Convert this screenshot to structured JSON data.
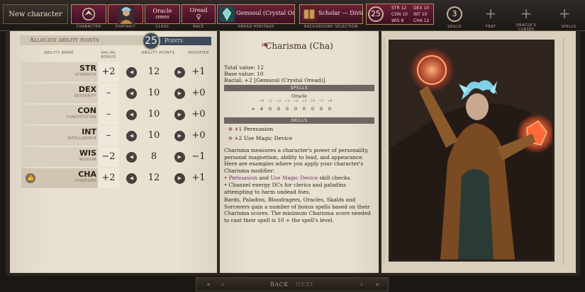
{
  "top": {
    "new_character": "New character",
    "steps": [
      {
        "label": "CHARACTER",
        "text": ""
      },
      {
        "label": "PORTRAIT",
        "text": ""
      },
      {
        "label": "CLASS",
        "text": "Oracle",
        "sub": "SEEKER"
      },
      {
        "label": "RACE",
        "text": "Oread"
      },
      {
        "label": "OREAD HERITAGE",
        "text": "Gemsoul (Crystal Oread)"
      },
      {
        "label": "BACKGROUND SELECTION",
        "text": "Scholar — Divine"
      }
    ],
    "points_total": "25",
    "stats": [
      {
        "k": "STR",
        "v": "12"
      },
      {
        "k": "DEX",
        "v": "10"
      },
      {
        "k": "CON",
        "v": "10"
      },
      {
        "k": "INT",
        "v": "10"
      },
      {
        "k": "WIS",
        "v": "8"
      },
      {
        "k": "CHA",
        "v": "12"
      }
    ],
    "skills_count": "3",
    "skills_label": "SKILLS",
    "feat_label": "FEAT",
    "oracle_curses_label": "ORACLE'S CURSES",
    "spells_label": "SPELLS"
  },
  "allocate": {
    "title": "Allocate ability points",
    "points_left": "25",
    "points_label": "Points",
    "headers": {
      "name": "ABILITY NAME",
      "bonus": "RACIAL BONUS",
      "points": "ABILITY POINTS",
      "modifier": "MODIFIER"
    },
    "rows": [
      {
        "abbr": "STR",
        "full": "STRENGTH",
        "bonus": "+2",
        "value": "12",
        "mod": "+1"
      },
      {
        "abbr": "DEX",
        "full": "DEXTERITY",
        "bonus": "–",
        "value": "10",
        "mod": "+0"
      },
      {
        "abbr": "CON",
        "full": "CONSTITUTION",
        "bonus": "–",
        "value": "10",
        "mod": "+0"
      },
      {
        "abbr": "INT",
        "full": "INTELLIGENCE",
        "bonus": "–",
        "value": "10",
        "mod": "+0"
      },
      {
        "abbr": "WIS",
        "full": "WISDOM",
        "bonus": "−2",
        "value": "8",
        "mod": "−1"
      },
      {
        "abbr": "CHA",
        "full": "CHARISMA",
        "bonus": "+2",
        "value": "12",
        "mod": "+1"
      }
    ]
  },
  "detail": {
    "title": "Charisma (Cha)",
    "total_value": "Total value: 12",
    "base_value": "Base value: 10",
    "racial": "Racial: +2 [Gemsoul (Crystal Oread)]",
    "spells_header": "SPELLS",
    "spells_class": "Oracle",
    "spell_levels": [
      "∞",
      "4",
      "0",
      "0",
      "0",
      "0",
      "0",
      "0",
      "0",
      "0"
    ],
    "spell_tags": [
      "",
      "+0",
      "+1",
      "+2",
      "+3",
      "+4",
      "+5",
      "+6",
      "+7",
      "+8"
    ],
    "skills_header": "SKILLS",
    "skill1": "+1 Persuasion",
    "skill2": "+2 Use Magic Device",
    "desc1": "Charisma measures a character's power of personality, personal magnetism, ability to lead, and appearance.",
    "desc2": "Here are examples where you apply your character's Charisma modifier:",
    "bullet1a": "Persuasion",
    "bullet1b": " and ",
    "bullet1c": "Use Magic Device",
    "bullet1d": " skill checks.",
    "bullet2": "Channel energy DCs for clerics and paladins attempting to harm undead foes.",
    "desc3": "Bards, Paladins, Bloodragers, Oracles, Skalds and Sorcerers gain a number of bonus spells based on their Charisma scores. The minimum Charisma score needed to cast their spell is 10 + the spell's level."
  },
  "nav": {
    "back": "BACK",
    "next": "NEXT"
  }
}
